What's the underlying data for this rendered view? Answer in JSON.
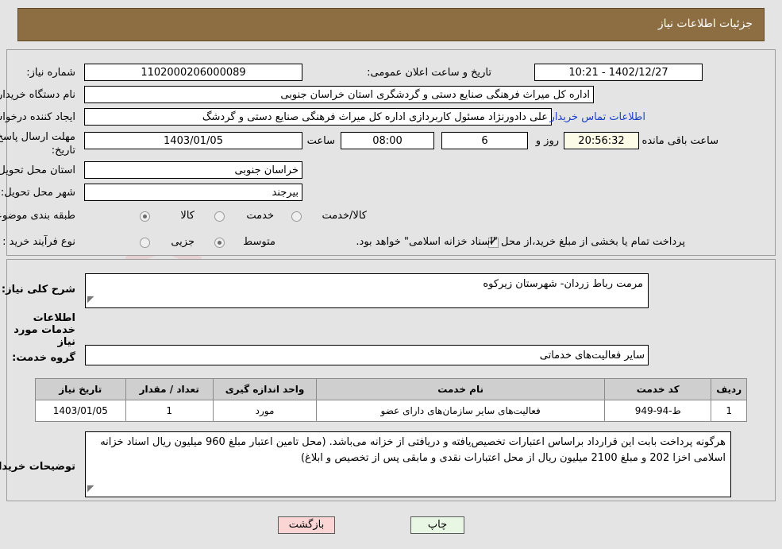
{
  "header": {
    "title": "جزئیات اطلاعات نیاز"
  },
  "watermark": {
    "text": "AnaTender.net"
  },
  "top_form": {
    "need_number_label": "شماره نیاز:",
    "need_number_value": "1102000206000089",
    "announce_label": "تاریخ و ساعت اعلان عمومی:",
    "announce_value": "1402/12/27 - 10:21",
    "buyer_org_label": "نام دستگاه خریدار:",
    "buyer_org_value": "اداره کل میراث فرهنگی  صنایع دستی و گردشگری استان خراسان جنوبی",
    "requester_label": "ایجاد کننده درخواست:",
    "requester_value": "علی دادورنژاد مسئول کاربردازی اداره کل میراث فرهنگی  صنایع دستی و گردشگ",
    "contact_link": "اطلاعات تماس خریدار",
    "deadline_label": "مهلت ارسال پاسخ: تا تاریخ:",
    "deadline_date": "1403/01/05",
    "hour_label": "ساعت",
    "hour_value": "08:00",
    "days_value": "6",
    "days_label": "روز و",
    "countdown_value": "20:56:32",
    "remaining_label": "ساعت باقی مانده",
    "province_label": "استان محل تحویل:",
    "province_value": "خراسان جنوبی",
    "city_label": "شهر محل تحویل:",
    "city_value": "بیرجند",
    "category_label": "طبقه بندی موضوعی:",
    "category_options": [
      {
        "label": "کالا",
        "selected": false
      },
      {
        "label": "خدمت",
        "selected": true
      },
      {
        "label": "کالا/خدمت",
        "selected": false
      }
    ],
    "process_label": "نوع فرآیند خرید :",
    "process_options": [
      {
        "label": "جزیی",
        "selected": false
      },
      {
        "label": "متوسط",
        "selected": true
      }
    ],
    "treasury_checked": true,
    "treasury_note": "پرداخت تمام یا بخشی از مبلغ خرید،از محل \"اسناد خزانه اسلامی\" خواهد بود."
  },
  "mid_form": {
    "overview_label": "شرح کلی نیاز:",
    "overview_value": "مرمت رباط زردان- شهرستان زیرکوه",
    "services_section_title": "اطلاعات خدمات مورد نیاز",
    "service_group_label": "گروه خدمت:",
    "service_group_value": "سایر فعالیت‌های خدماتی",
    "buyer_notes_label": "توضیحات خریدار:",
    "buyer_notes_value": "هرگونه پرداخت بابت این قرارداد براساس اعتبارات تخصیص‌یافته و دریافتی از خزانه می‌باشد. (محل تامین اعتبار مبلغ 960 میلیون ریال اسناد خزانه اسلامی اخزا 202 و مبلغ 2100 میلیون ریال از محل اعتبارات نقدی و مابقی پس از تخصیص و ابلاغ)"
  },
  "table": {
    "headers": [
      "ردیف",
      "کد خدمت",
      "نام خدمت",
      "واحد اندازه گیری",
      "تعداد / مقدار",
      "تاریخ نیاز"
    ],
    "rows": [
      {
        "row": "1",
        "code": "ط-94-949",
        "name": "فعالیت‌های سایر سازمان‌های دارای عضو",
        "unit": "مورد",
        "qty": "1",
        "date": "1403/01/05"
      }
    ]
  },
  "footer": {
    "back_label": "بازگشت",
    "print_label": "چاپ"
  },
  "colors": {
    "header_brown": "#8d6e43",
    "link_blue": "#1a3fcb",
    "table_header_gray": "#cfcfcf",
    "back_button_pink": "#fbd4d4",
    "print_button_green": "#e8f7e4",
    "countdown_cream": "#fbfbe8"
  }
}
